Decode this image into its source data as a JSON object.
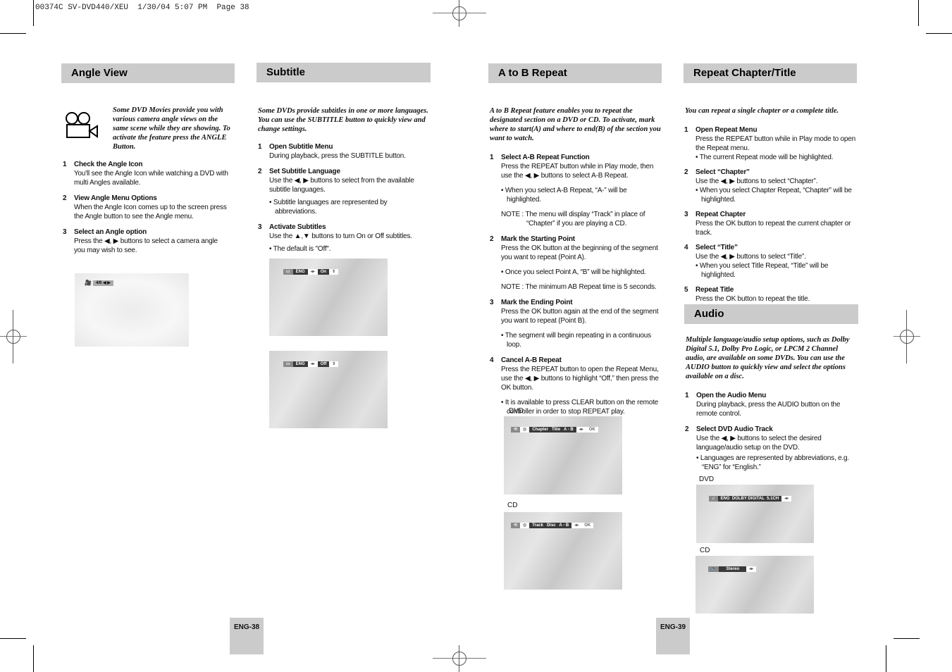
{
  "slug": "00374C SV-DVD440/XEU  1/30/04 5:07 PM  Page 38",
  "sections": {
    "angle_view": {
      "title": "Angle View",
      "icon": "movie-camera-icon",
      "intro": "Some DVD Movies provide you with various camera angle views on the same scene while they are showing. To activate the feature press the ANGLE Button.",
      "steps": [
        {
          "num": "1",
          "title": "Check the Angle Icon",
          "body": "You'll see the Angle Icon while watching a DVD with multi Angles available."
        },
        {
          "num": "2",
          "title": "View Angle Menu Options",
          "body": "When the Angle Icon comes up to the screen press the Angle button to see the Angle menu."
        },
        {
          "num": "3",
          "title": "Select an Angle option",
          "body": "Press the ◀, ▶ buttons to select a camera angle you may wish to see."
        }
      ],
      "screen": {
        "value": "4/6 ◀ ▶"
      }
    },
    "subtitle": {
      "title": "Subtitle",
      "intro": "Some DVDs provide subtitles in one or more languages. You can use the SUBTITLE button to quickly view and change settings.",
      "steps": [
        {
          "num": "1",
          "title": "Open Subtitle Menu",
          "body": "During playback, press the SUBTITLE button."
        },
        {
          "num": "2",
          "title": "Set Subtitle Language",
          "body": "Use the ◀, ▶ buttons to select from the available subtitle languages.",
          "bullet": "• Subtitle languages are represented by abbreviations."
        },
        {
          "num": "3",
          "title": "Activate Subtitles",
          "body": "Use the ▲,▼ buttons to turn On or Off subtitles.",
          "bullet": "• The default is \"Off\"."
        }
      ],
      "screens": [
        {
          "lang": "ENG",
          "state": "On"
        },
        {
          "lang": "ENG",
          "state": "Off"
        }
      ]
    },
    "ab_repeat": {
      "title": "A to B Repeat",
      "intro": "A to B Repeat feature enables you to repeat the designated section on a DVD or CD.  To activate, mark where to start(A) and where to end(B) of the section you want to watch.",
      "steps": [
        {
          "num": "1",
          "title": "Select A-B Repeat Function",
          "body": "Press the REPEAT button while in Play mode, then use the ◀, ▶ buttons to select A-B Repeat.",
          "bullet": "• When you select A-B Repeat, “A-” will be highlighted.",
          "note": "NOTE :  The menu will display “Track” in place of “Chapter” if you are playing a CD."
        },
        {
          "num": "2",
          "title": "Mark the Starting Point",
          "body": "Press the OK button at the beginning of the segment you want to repeat (Point A).",
          "bullet": "• Once you select Point A, “B” will be highlighted.",
          "note": "NOTE :  The minimum AB Repeat time is 5 seconds."
        },
        {
          "num": "3",
          "title": "Mark the Ending Point",
          "body": "Press the OK button again at the end of the segment you want to repeat (Point B).",
          "bullet": "• The segment will begin repeating in a continuous loop."
        },
        {
          "num": "4",
          "title": "Cancel A-B Repeat",
          "body": "Press the REPEAT button to open the Repeat Menu, use the ◀, ▶ buttons to highlight “Off,” then press the OK button.",
          "bullet": "• It is available to press CLEAR button on the remote controller in order to stop REPEAT play."
        }
      ],
      "screens": [
        {
          "caption": "DVD",
          "menu": "Chapter   Title   A - B",
          "ok": "OK"
        },
        {
          "caption": "CD",
          "menu": "Track   Disc   A - B",
          "ok": "OK"
        }
      ]
    },
    "repeat_chapter": {
      "title": "Repeat Chapter/Title",
      "intro": "You can repeat a single chapter or a complete title.",
      "steps": [
        {
          "num": "1",
          "title": "Open Repeat Menu",
          "body": "Press the REPEAT button while in Play mode to open the Repeat menu.",
          "bullet": "• The current Repeat mode will be highlighted."
        },
        {
          "num": "2",
          "title": "Select “Chapter”",
          "body": "Use the ◀, ▶ buttons to select “Chapter”.",
          "bullet": "• When you select Chapter Repeat, “Chapter” will be highlighted."
        },
        {
          "num": "3",
          "title": "Repeat Chapter",
          "body": "Press the OK button to repeat the current chapter or track."
        },
        {
          "num": "4",
          "title": "Select “Title”",
          "body": "Use the ◀, ▶ buttons to select “Title”.",
          "bullet": "• When you select Title Repeat, “Title” will be highlighted."
        },
        {
          "num": "5",
          "title": "Repeat Title",
          "body": "Press the OK button to repeat the title."
        }
      ]
    },
    "audio": {
      "title": "Audio",
      "intro": "Multiple language/audio setup options, such as Dolby Digital 5.1, Dolby Pro Logic, or LPCM 2 Channel audio, are available on some DVDs. You can use the AUDIO button to quickly view and  select the options available on a disc.",
      "steps": [
        {
          "num": "1",
          "title": "Open the Audio Menu",
          "body": "During playback, press the AUDIO button on the remote control."
        },
        {
          "num": "2",
          "title": "Select DVD Audio Track",
          "body": "Use the ◀, ▶ buttons to select the desired language/audio setup on the DVD.",
          "bullet": "• Languages are represented by abbreviations, e.g. “ENG” for “English.”"
        }
      ],
      "screens": [
        {
          "caption": "DVD",
          "value": "ENG  DOLBY DIGITAL  5.1CH"
        },
        {
          "caption": "CD",
          "value": "Stereo"
        }
      ]
    }
  },
  "pages": {
    "left": "ENG-38",
    "right": "ENG-39"
  }
}
